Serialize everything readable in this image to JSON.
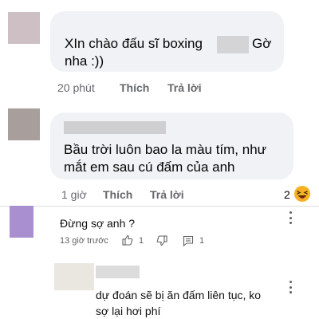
{
  "comments": [
    {
      "lines": [
        "XIn chào đấu sĩ boxing",
        "Gờ",
        "nha :))"
      ],
      "time": "20 phút",
      "like": "Thích",
      "reply": "Trả lời"
    },
    {
      "lines": [
        "Bầu trời luôn bao la màu tím, như",
        "mắt em sau cú đấm của anh"
      ],
      "time": "1 giờ",
      "like": "Thích",
      "reply": "Trả lời",
      "reaction_count": "2",
      "reaction_icon": "laughing-emoji-icon"
    }
  ],
  "yt_comments": [
    {
      "text": "Đừng sợ anh ?",
      "time": "13 giờ trước",
      "likes": "1",
      "replies": "1"
    },
    {
      "lines": [
        "dự đoán sẽ bị ăn đấm liên tục, ko",
        "sợ lại hơi phí"
      ]
    }
  ],
  "colors": {
    "bubble": "#f0f2f5",
    "meta": "#65676b",
    "avatar1": "#c9b9bd",
    "avatar2": "#a89e9c",
    "avatar3": "#a98fcf",
    "emoji": "#f7b125"
  }
}
